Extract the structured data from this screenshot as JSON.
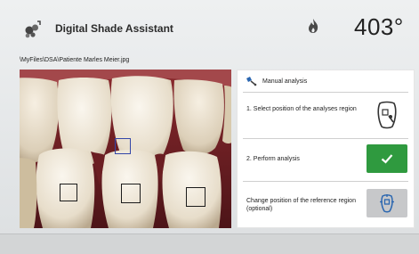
{
  "header": {
    "title": "Digital Shade Assistant",
    "temperature": "403°",
    "app_icon": "teeth-icon",
    "status_icon": "flame-icon"
  },
  "file_path": "\\MyFiles\\DSA\\Patiente Marles Meier.jpg",
  "panel": {
    "mode_label": "Manual analysis",
    "mode_icon": "tooth-brush-icon",
    "step1": "1. Select position of the analyses region",
    "step1_icon": "tooth-select-icon",
    "step2": "2. Perform analysis",
    "step2_icon": "check-icon",
    "step3": "Change position of the reference region (optional)",
    "step3_icon": "reference-region-icon"
  },
  "colors": {
    "ok_green": "#2f9a3f",
    "reference_marker": "#3346a8"
  }
}
